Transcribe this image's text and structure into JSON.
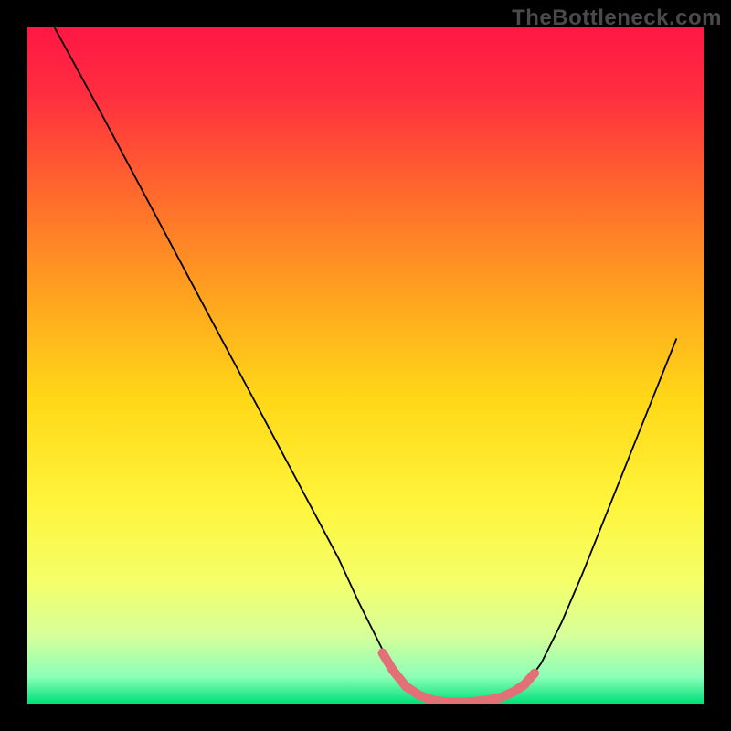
{
  "watermark": "TheBottleneck.com",
  "chart_data": {
    "type": "line",
    "title": "",
    "xlabel": "",
    "ylabel": "",
    "xlim": [
      0,
      100
    ],
    "ylim": [
      0,
      100
    ],
    "gradient_stops": [
      {
        "offset": 0.0,
        "color": "#ff1744"
      },
      {
        "offset": 0.1,
        "color": "#ff2e3f"
      },
      {
        "offset": 0.25,
        "color": "#ff6b2c"
      },
      {
        "offset": 0.4,
        "color": "#ffa41f"
      },
      {
        "offset": 0.55,
        "color": "#ffd817"
      },
      {
        "offset": 0.7,
        "color": "#fff43a"
      },
      {
        "offset": 0.82,
        "color": "#f4ff6a"
      },
      {
        "offset": 0.9,
        "color": "#d6ff9a"
      },
      {
        "offset": 0.96,
        "color": "#8cffb8"
      },
      {
        "offset": 1.0,
        "color": "#00e079"
      }
    ],
    "series": [
      {
        "name": "curve",
        "stroke": "#000000",
        "stroke_width": 1.8,
        "points": [
          {
            "x": 4.0,
            "y": 100.0
          },
          {
            "x": 7.0,
            "y": 94.5
          },
          {
            "x": 10.0,
            "y": 89.0
          },
          {
            "x": 14.0,
            "y": 81.5
          },
          {
            "x": 18.0,
            "y": 74.0
          },
          {
            "x": 22.0,
            "y": 66.5
          },
          {
            "x": 26.0,
            "y": 59.0
          },
          {
            "x": 30.0,
            "y": 51.5
          },
          {
            "x": 34.0,
            "y": 44.0
          },
          {
            "x": 38.0,
            "y": 36.5
          },
          {
            "x": 42.0,
            "y": 29.0
          },
          {
            "x": 46.0,
            "y": 21.5
          },
          {
            "x": 49.0,
            "y": 15.0
          },
          {
            "x": 52.0,
            "y": 9.0
          },
          {
            "x": 54.0,
            "y": 5.0
          },
          {
            "x": 56.0,
            "y": 2.2
          },
          {
            "x": 58.0,
            "y": 0.8
          },
          {
            "x": 60.0,
            "y": 0.3
          },
          {
            "x": 62.0,
            "y": 0.0
          },
          {
            "x": 64.0,
            "y": 0.0
          },
          {
            "x": 66.0,
            "y": 0.1
          },
          {
            "x": 68.0,
            "y": 0.3
          },
          {
            "x": 70.0,
            "y": 0.7
          },
          {
            "x": 72.0,
            "y": 1.5
          },
          {
            "x": 74.0,
            "y": 3.2
          },
          {
            "x": 76.0,
            "y": 6.0
          },
          {
            "x": 79.0,
            "y": 12.0
          },
          {
            "x": 82.0,
            "y": 19.0
          },
          {
            "x": 85.0,
            "y": 26.5
          },
          {
            "x": 88.0,
            "y": 34.0
          },
          {
            "x": 91.0,
            "y": 41.5
          },
          {
            "x": 94.0,
            "y": 49.0
          },
          {
            "x": 96.0,
            "y": 54.0
          }
        ]
      },
      {
        "name": "accent",
        "stroke": "#e27076",
        "stroke_width": 10,
        "linecap": "round",
        "points": [
          {
            "x": 52.5,
            "y": 7.5
          },
          {
            "x": 54.0,
            "y": 5.0
          },
          {
            "x": 56.0,
            "y": 2.5
          },
          {
            "x": 58.0,
            "y": 1.2
          },
          {
            "x": 60.0,
            "y": 0.5
          },
          {
            "x": 62.0,
            "y": 0.2
          },
          {
            "x": 64.0,
            "y": 0.2
          },
          {
            "x": 66.0,
            "y": 0.3
          },
          {
            "x": 68.0,
            "y": 0.5
          },
          {
            "x": 70.0,
            "y": 0.9
          },
          {
            "x": 72.0,
            "y": 1.8
          },
          {
            "x": 73.5,
            "y": 2.8
          },
          {
            "x": 75.0,
            "y": 4.5
          }
        ]
      }
    ]
  }
}
